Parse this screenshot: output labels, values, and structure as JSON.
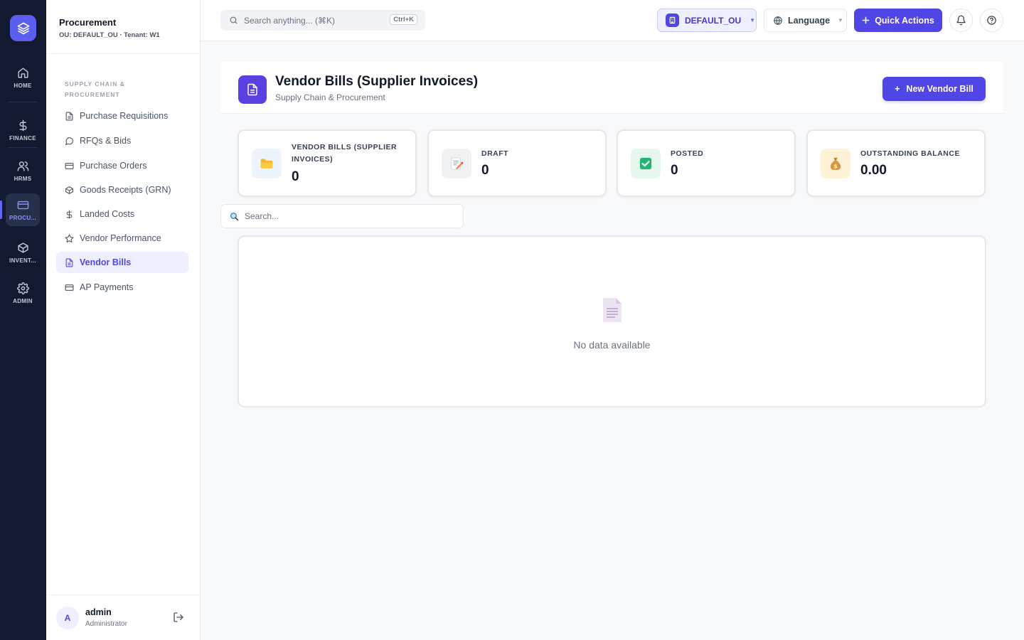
{
  "rail": {
    "items": [
      {
        "label": "HOME",
        "icon": "home-icon"
      },
      {
        "label": "FINANCE",
        "icon": "dollar-icon"
      },
      {
        "label": "HRMS",
        "icon": "users-icon"
      },
      {
        "label": "PROCU...",
        "icon": "card-icon",
        "active": true
      },
      {
        "label": "INVENT...",
        "icon": "box-icon"
      },
      {
        "label": "ADMIN",
        "icon": "gear-icon"
      }
    ]
  },
  "sidebar": {
    "title": "Procurement",
    "subtitle": "OU: DEFAULT_OU · Tenant: W1",
    "section": "SUPPLY CHAIN & PROCUREMENT",
    "items": [
      {
        "label": "Purchase Requisitions",
        "icon": "document-icon"
      },
      {
        "label": "RFQs & Bids",
        "icon": "chat-icon"
      },
      {
        "label": "Purchase Orders",
        "icon": "card-icon"
      },
      {
        "label": "Goods Receipts (GRN)",
        "icon": "box-icon"
      },
      {
        "label": "Landed Costs",
        "icon": "dollar-icon"
      },
      {
        "label": "Vendor Performance",
        "icon": "star-icon"
      },
      {
        "label": "Vendor Bills",
        "icon": "document-icon",
        "active": true
      },
      {
        "label": "AP Payments",
        "icon": "card-icon"
      }
    ],
    "user": {
      "initial": "A",
      "name": "admin",
      "role": "Administrator"
    }
  },
  "topbar": {
    "search_placeholder": "Search anything... (⌘K)",
    "shortcut": "Ctrl+K",
    "ou": "DEFAULT_OU",
    "language": "Language",
    "quick_actions": "Quick Actions"
  },
  "page": {
    "title": "Vendor Bills (Supplier Invoices)",
    "subtitle": "Supply Chain & Procurement",
    "new_button": "New Vendor Bill"
  },
  "stats": [
    {
      "label": "VENDOR BILLS (SUPPLIER INVOICES)",
      "value": "0",
      "icon": "folder-icon",
      "bg": "#eef4fb"
    },
    {
      "label": "DRAFT",
      "value": "0",
      "icon": "memo-icon",
      "bg": "#f1f2f4"
    },
    {
      "label": "POSTED",
      "value": "0",
      "icon": "check-icon",
      "bg": "#e6f7ee"
    },
    {
      "label": "OUTSTANDING BALANCE",
      "value": "0.00",
      "icon": "money-bag-icon",
      "bg": "#fdf2d6"
    }
  ],
  "table": {
    "search_placeholder": "Search...",
    "empty_text": "No data available"
  },
  "colors": {
    "accent": "#4f46e5",
    "rail_bg": "#111a30"
  }
}
